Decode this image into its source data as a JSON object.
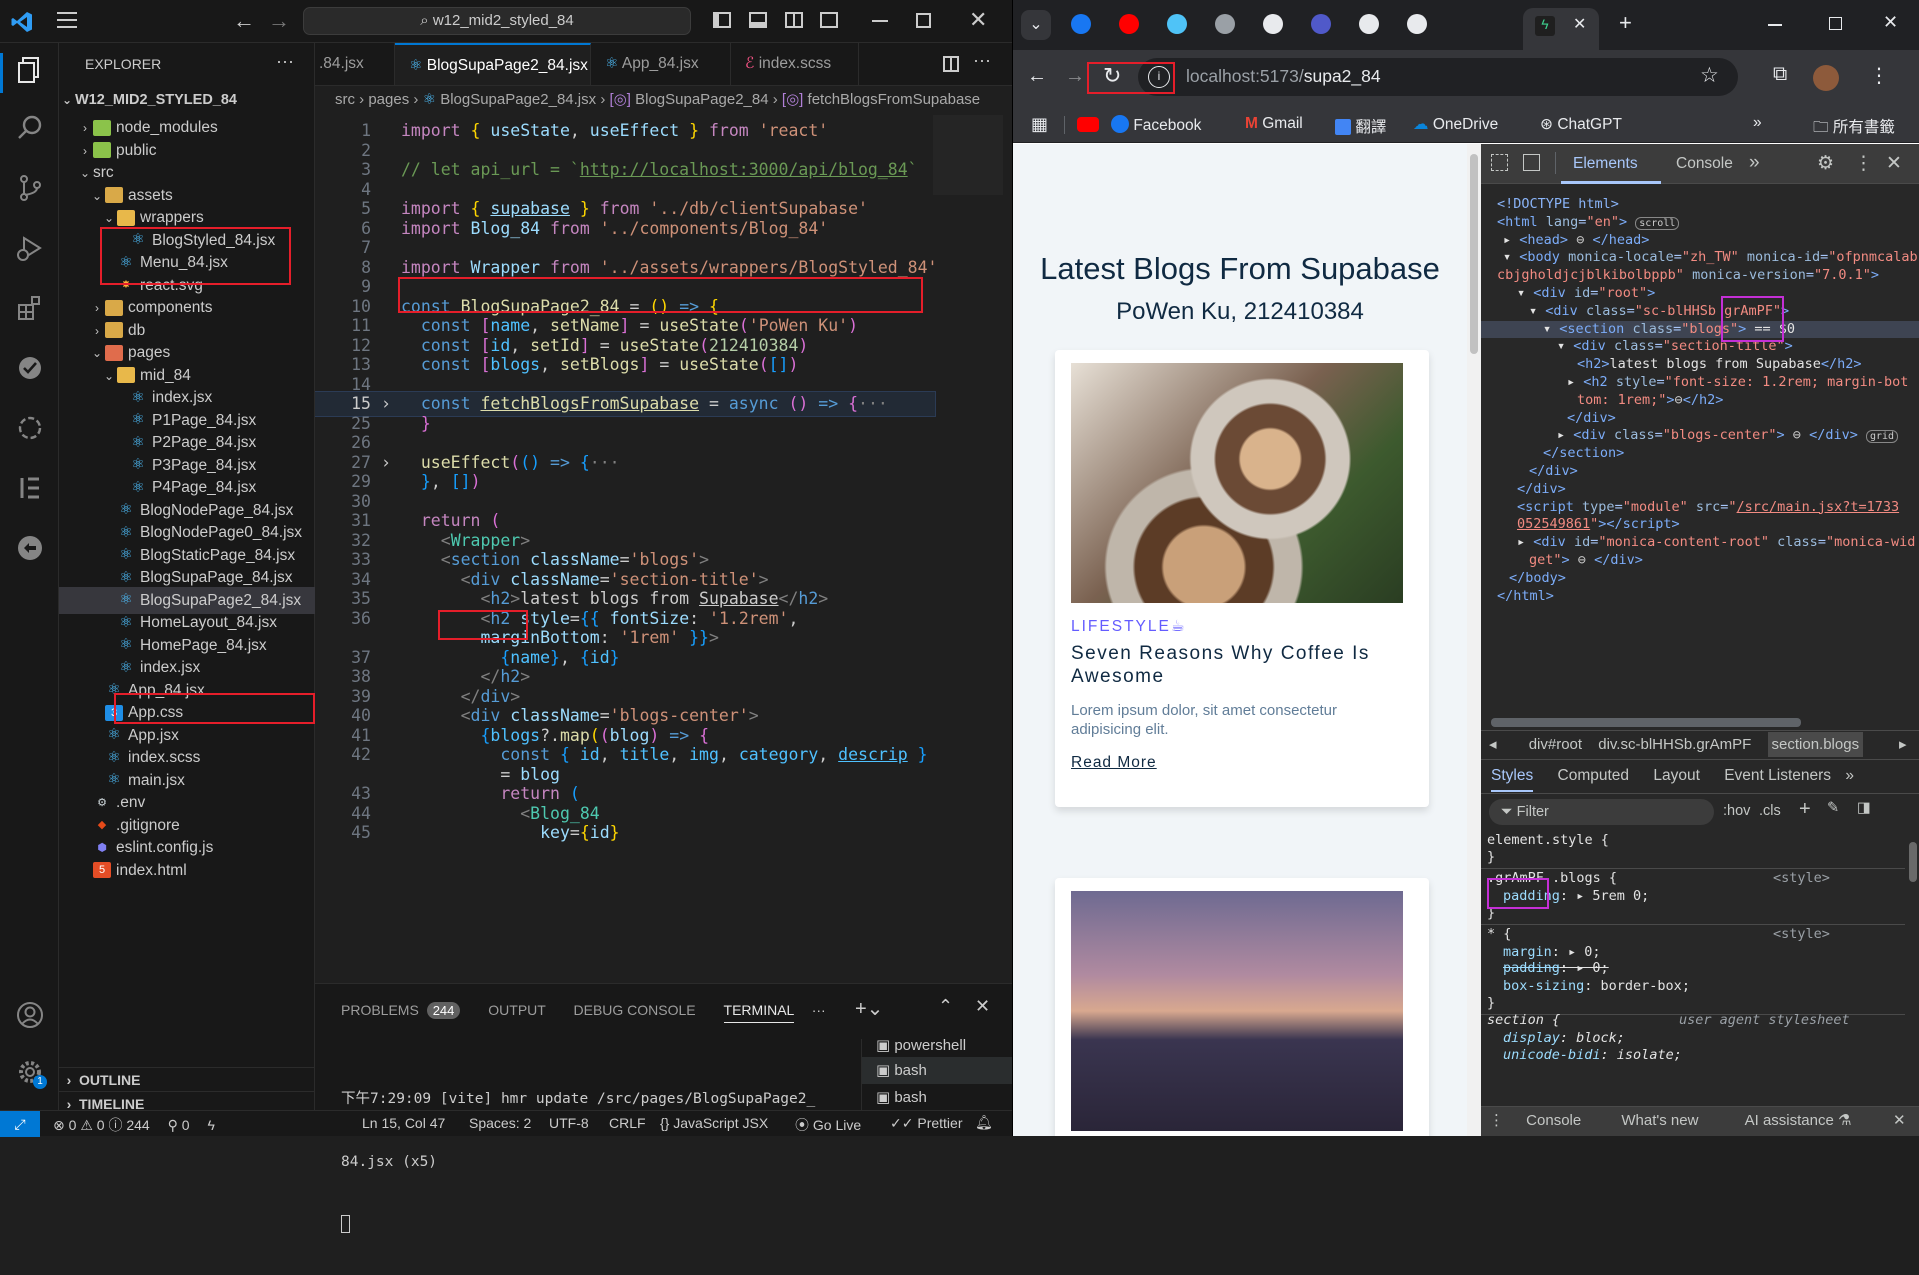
{
  "vscode": {
    "search_box": "w12_mid2_styled_84",
    "explorer_title": "EXPLORER",
    "explorer_more": "···",
    "root_folder": "W12_MID2_STYLED_84",
    "tree": [
      {
        "label": "node_modules",
        "depth": 1,
        "arrow": "›",
        "icon": "folder-green"
      },
      {
        "label": "public",
        "depth": 1,
        "arrow": "›",
        "icon": "folder-green"
      },
      {
        "label": "src",
        "depth": 1,
        "arrow": "⌄",
        "icon": "none"
      },
      {
        "label": "assets",
        "depth": 2,
        "arrow": "⌄",
        "icon": "folder-orange"
      },
      {
        "label": "wrappers",
        "depth": 3,
        "arrow": "⌄",
        "icon": "folder-yellow"
      },
      {
        "label": "BlogStyled_84.jsx",
        "depth": 4,
        "arrow": "",
        "icon": "react"
      },
      {
        "label": "Menu_84.jsx",
        "depth": 3,
        "arrow": "",
        "icon": "react"
      },
      {
        "label": "react.svg",
        "depth": 3,
        "arrow": "",
        "icon": "svg"
      },
      {
        "label": "components",
        "depth": 2,
        "arrow": "›",
        "icon": "folder-orange"
      },
      {
        "label": "db",
        "depth": 2,
        "arrow": "›",
        "icon": "folder-orange"
      },
      {
        "label": "pages",
        "depth": 2,
        "arrow": "⌄",
        "icon": "folder-red"
      },
      {
        "label": "mid_84",
        "depth": 3,
        "arrow": "⌄",
        "icon": "folder-yellow"
      },
      {
        "label": "index.jsx",
        "depth": 4,
        "arrow": "",
        "icon": "react"
      },
      {
        "label": "P1Page_84.jsx",
        "depth": 4,
        "arrow": "",
        "icon": "react"
      },
      {
        "label": "P2Page_84.jsx",
        "depth": 4,
        "arrow": "",
        "icon": "react"
      },
      {
        "label": "P3Page_84.jsx",
        "depth": 4,
        "arrow": "",
        "icon": "react"
      },
      {
        "label": "P4Page_84.jsx",
        "depth": 4,
        "arrow": "",
        "icon": "react"
      },
      {
        "label": "BlogNodePage_84.jsx",
        "depth": 3,
        "arrow": "",
        "icon": "react"
      },
      {
        "label": "BlogNodePage0_84.jsx",
        "depth": 3,
        "arrow": "",
        "icon": "react"
      },
      {
        "label": "BlogStaticPage_84.jsx",
        "depth": 3,
        "arrow": "",
        "icon": "react"
      },
      {
        "label": "BlogSupaPage_84.jsx",
        "depth": 3,
        "arrow": "",
        "icon": "react"
      },
      {
        "label": "BlogSupaPage2_84.jsx",
        "depth": 3,
        "arrow": "",
        "icon": "react"
      },
      {
        "label": "HomeLayout_84.jsx",
        "depth": 3,
        "arrow": "",
        "icon": "react"
      },
      {
        "label": "HomePage_84.jsx",
        "depth": 3,
        "arrow": "",
        "icon": "react"
      },
      {
        "label": "index.jsx",
        "depth": 3,
        "arrow": "",
        "icon": "react"
      },
      {
        "label": "App_84.jsx",
        "depth": 2,
        "arrow": "",
        "icon": "react"
      },
      {
        "label": "App.css",
        "depth": 2,
        "arrow": "",
        "icon": "css"
      },
      {
        "label": "App.jsx",
        "depth": 2,
        "arrow": "",
        "icon": "react"
      },
      {
        "label": "index.scss",
        "depth": 2,
        "arrow": "",
        "icon": "react"
      },
      {
        "label": "main.jsx",
        "depth": 2,
        "arrow": "",
        "icon": "react"
      },
      {
        "label": ".env",
        "depth": 1,
        "arrow": "",
        "icon": "gear"
      },
      {
        "label": ".gitignore",
        "depth": 1,
        "arrow": "",
        "icon": "git"
      },
      {
        "label": "eslint.config.js",
        "depth": 1,
        "arrow": "",
        "icon": "eslint"
      },
      {
        "label": "index.html",
        "depth": 1,
        "arrow": "",
        "icon": "html"
      }
    ],
    "outline": "OUTLINE",
    "timeline": "TIMELINE",
    "tabs": [
      {
        "label": ".84.jsx"
      },
      {
        "label": "BlogSupaPage2_84.jsx",
        "close": "✕"
      },
      {
        "label": "App_84.jsx"
      },
      {
        "label": "index.scss"
      }
    ],
    "breadcrumb": [
      "src",
      "pages",
      "BlogSupaPage2_84.jsx",
      "BlogSupaPage2_84",
      "fetchBlogsFromSupabase"
    ],
    "line_numbers": [
      "1",
      "2",
      "3",
      "4",
      "5",
      "6",
      "7",
      "8",
      "9",
      "10",
      "11",
      "12",
      "13",
      "14",
      "15",
      "25",
      "26",
      "27",
      "29",
      "30",
      "31",
      "32",
      "33",
      "34",
      "35",
      "36",
      "",
      "37",
      "38",
      "39",
      "40",
      "41",
      "42",
      "",
      "43",
      "44",
      "45"
    ],
    "panel_tabs": [
      "PROBLEMS",
      "244",
      "OUTPUT",
      "DEBUG CONSOLE",
      "TERMINAL",
      "···"
    ],
    "terminal_line1": "下午7:29:09 [vite] hmr update /src/pages/BlogSupaPage2_",
    "terminal_line2": "84.jsx (x5)",
    "terminal_sessions": [
      "powershell",
      "bash",
      "bash"
    ],
    "status": {
      "errors": "0",
      "warnings": "0",
      "info": "244",
      "ports": "0",
      "position": "Ln 15, Col 47",
      "spaces": "Spaces: 2",
      "encoding": "UTF-8",
      "eol": "CRLF",
      "language": "JavaScript JSX",
      "golive": "Go Live",
      "prettier": "Prettier"
    }
  },
  "browser": {
    "tabs_count_label": "",
    "url_host": "localhost:5173/",
    "url_path": "supa2_84",
    "bookmarks": [
      "Facebook",
      "Gmail",
      "翻譯",
      "OneDrive",
      "ChatGPT"
    ],
    "all_bookmarks": "所有書籤",
    "page": {
      "title": "Latest Blogs From Supabase",
      "subtitle": "PoWen Ku, 212410384",
      "card1": {
        "category": "LIFESTYLE☕",
        "title": "Seven Reasons Why Coffee Is Awesome",
        "desc": "Lorem ipsum dolor, sit amet consectetur adipisicing elit.",
        "link": "Read More"
      }
    },
    "devtools": {
      "tabs": [
        "Elements",
        "Console"
      ],
      "breadcrumb": [
        "div#root",
        "div.sc-blHHSb.grAmPF",
        "section.blogs"
      ],
      "style_tabs": [
        "Styles",
        "Computed",
        "Layout",
        "Event Listeners"
      ],
      "filter_placeholder": "Filter",
      "hov": ":hov",
      "cls": ".cls",
      "bottom_tabs": [
        "Console",
        "What's new",
        "AI assistance"
      ]
    }
  }
}
